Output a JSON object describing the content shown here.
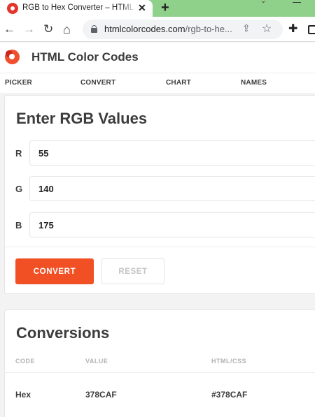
{
  "browser": {
    "tab_title": "RGB to Hex Converter – HTML Color Codes",
    "tab_close": "✕",
    "new_tab": "+",
    "url_domain": "htmlcolorcodes.com",
    "url_path": "/rgb-to-he...",
    "icons": [
      "back-icon",
      "forward-icon",
      "reload-icon",
      "home-icon",
      "lock-icon",
      "share-icon",
      "star-icon",
      "extensions-icon",
      "side-panel-icon"
    ]
  },
  "site": {
    "title": "HTML Color Codes",
    "nav": [
      "PICKER",
      "CONVERT",
      "CHART",
      "NAMES"
    ]
  },
  "rgb_form": {
    "heading": "Enter RGB Values",
    "fields": [
      {
        "label": "R",
        "value": "55"
      },
      {
        "label": "G",
        "value": "140"
      },
      {
        "label": "B",
        "value": "175"
      }
    ],
    "convert_label": "CONVERT",
    "reset_label": "RESET",
    "accent_color": "#f15025"
  },
  "conversions": {
    "heading": "Conversions",
    "columns": [
      "CODE",
      "VALUE",
      "HTML/CSS"
    ],
    "rows": [
      {
        "code": "Hex",
        "value": "378CAF",
        "css": "#378CAF"
      }
    ]
  }
}
